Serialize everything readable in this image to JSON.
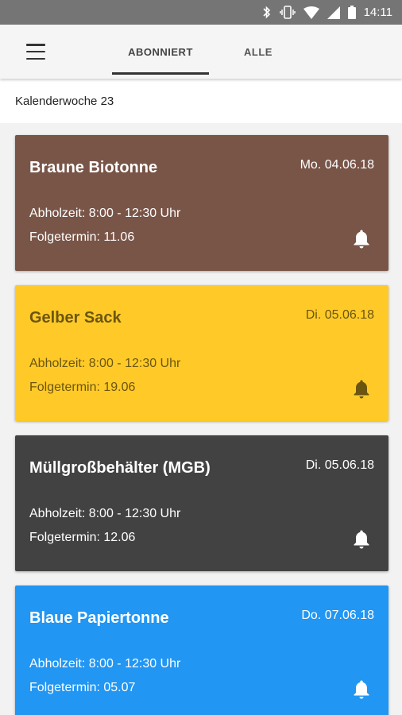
{
  "statusbar": {
    "time": "14:11"
  },
  "tabs": [
    {
      "label": "ABONNIERT",
      "active": true
    },
    {
      "label": "ALLE",
      "active": false
    }
  ],
  "week_label": "Kalenderwoche 23",
  "cards": [
    {
      "title": "Braune Biotonne",
      "date": "Mo. 04.06.18",
      "time": "Abholzeit: 8:00 - 12:30 Uhr",
      "next": "Folgetermin: 11.06",
      "bg": "#795548",
      "fg": "#ffffff"
    },
    {
      "title": "Gelber Sack",
      "date": "Di. 05.06.18",
      "time": "Abholzeit: 8:00 - 12:30 Uhr",
      "next": "Folgetermin: 19.06",
      "bg": "#FFCA28",
      "fg": "#6b5510"
    },
    {
      "title": "Müllgroßbehälter (MGB)",
      "date": "Di. 05.06.18",
      "time": "Abholzeit: 8:00 - 12:30 Uhr",
      "next": "Folgetermin: 12.06",
      "bg": "#424242",
      "fg": "#ffffff"
    },
    {
      "title": "Blaue Papiertonne",
      "date": "Do. 07.06.18",
      "time": "Abholzeit: 8:00 - 12:30 Uhr",
      "next": "Folgetermin: 05.07",
      "bg": "#2196F3",
      "fg": "#ffffff"
    }
  ],
  "icons": {
    "menu": "hamburger-menu-icon",
    "bell": "bell-icon",
    "bluetooth": "bluetooth-icon",
    "vibrate": "vibrate-icon",
    "wifi": "wifi-icon",
    "signal": "signal-icon",
    "battery": "battery-icon"
  }
}
